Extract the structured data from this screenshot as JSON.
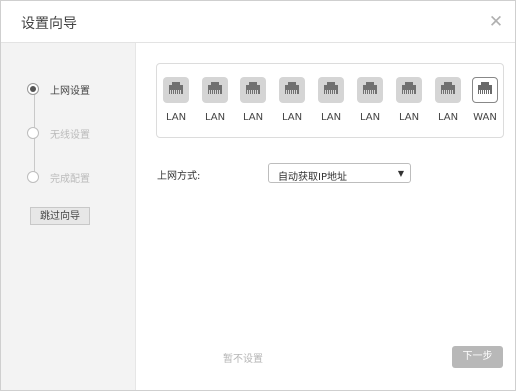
{
  "dialog": {
    "title": "设置向导",
    "close_icon": "close-icon"
  },
  "steps": [
    {
      "label": "上网设置",
      "state": "active"
    },
    {
      "label": "无线设置",
      "state": "inactive"
    },
    {
      "label": "完成配置",
      "state": "inactive"
    }
  ],
  "sidebar": {
    "skip_label": "跳过向导"
  },
  "ports": [
    {
      "label": "LAN",
      "type": "lan"
    },
    {
      "label": "LAN",
      "type": "lan"
    },
    {
      "label": "LAN",
      "type": "lan"
    },
    {
      "label": "LAN",
      "type": "lan"
    },
    {
      "label": "LAN",
      "type": "lan"
    },
    {
      "label": "LAN",
      "type": "lan"
    },
    {
      "label": "LAN",
      "type": "lan"
    },
    {
      "label": "LAN",
      "type": "lan"
    },
    {
      "label": "WAN",
      "type": "wan"
    }
  ],
  "connection": {
    "label": "上网方式:",
    "selected": "自动获取IP地址"
  },
  "footer": {
    "later_label": "暂不设置",
    "next_label": "下一步"
  },
  "colors": {
    "next_button": "#b8b8b8",
    "sidebar_bg": "#f3f3f3"
  }
}
